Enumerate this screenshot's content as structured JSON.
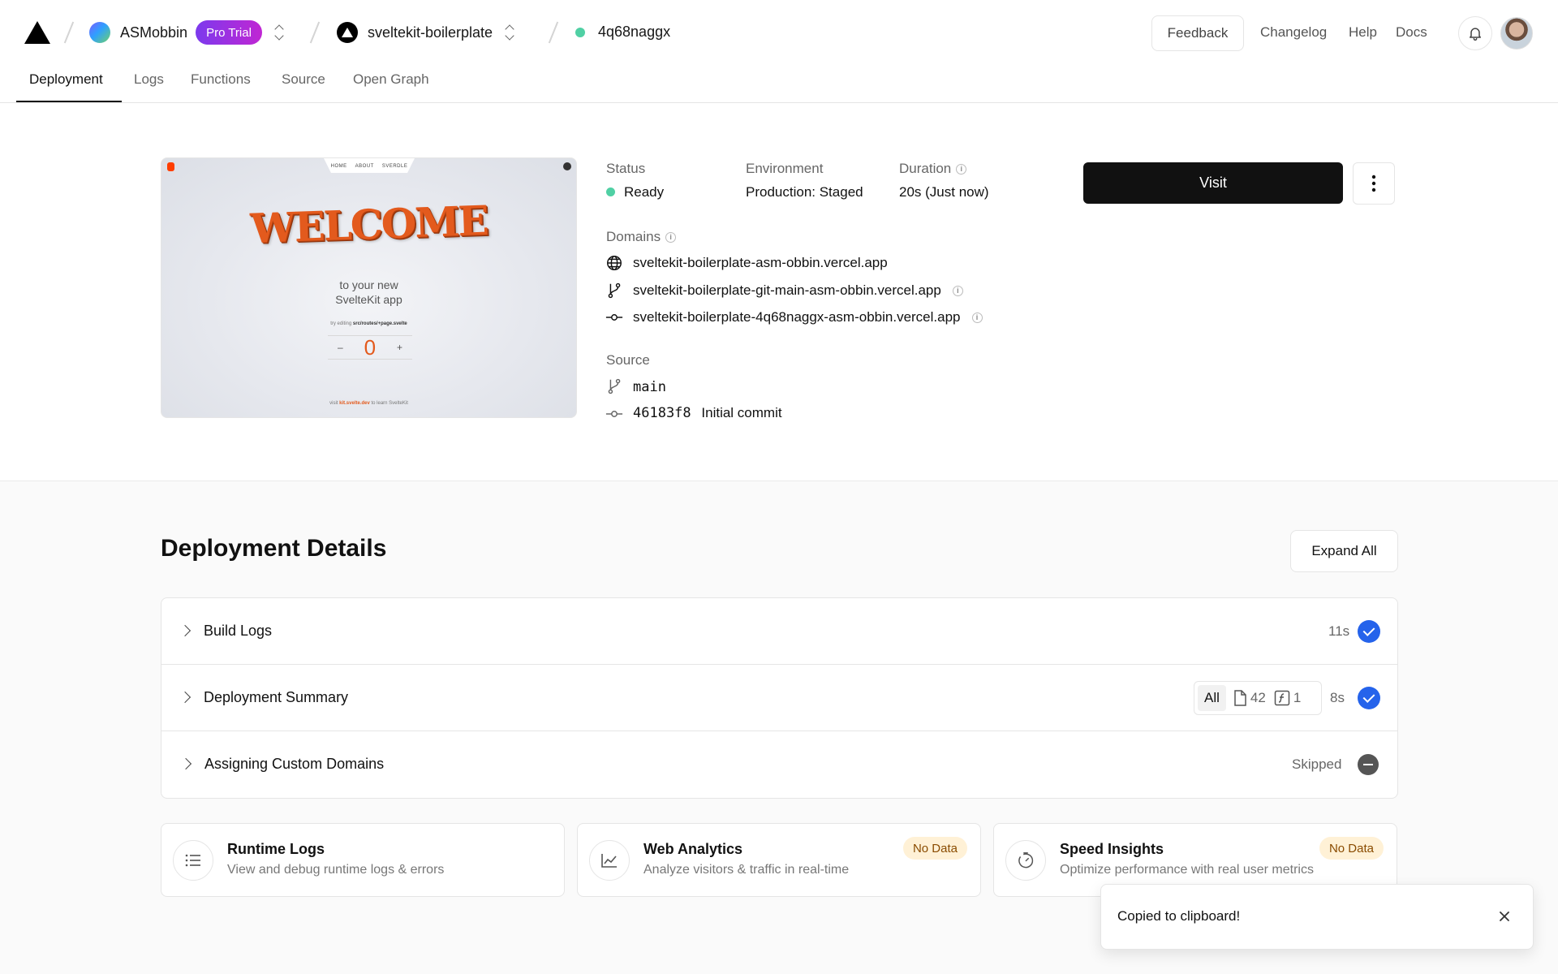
{
  "header": {
    "team_name": "ASMobbin",
    "plan_badge": "Pro Trial",
    "project_name": "sveltekit-boilerplate",
    "deployment_id": "4q68naggx",
    "feedback_label": "Feedback",
    "links": [
      "Changelog",
      "Help",
      "Docs"
    ]
  },
  "tabs": [
    "Deployment",
    "Logs",
    "Functions",
    "Source",
    "Open Graph"
  ],
  "preview": {
    "nav": [
      "HOME",
      "ABOUT",
      "SVERDLE"
    ],
    "heading": "WELCOME",
    "subtitle_line1": "to your new",
    "subtitle_line2": "SvelteKit app",
    "try_text": "try editing",
    "try_path": "src/routes/+page.svelte",
    "counter_minus": "–",
    "counter_value": "0",
    "counter_plus": "+",
    "footer_prefix": "visit",
    "footer_link": "kit.svelte.dev",
    "footer_suffix": "to learn SvelteKit"
  },
  "overview": {
    "status_label": "Status",
    "status_value": "Ready",
    "environment_label": "Environment",
    "environment_value": "Production: Staged",
    "duration_label": "Duration",
    "duration_value": "20s (Just now)",
    "domains_label": "Domains",
    "domains": [
      "sveltekit-boilerplate-asm-obbin.vercel.app",
      "sveltekit-boilerplate-git-main-asm-obbin.vercel.app",
      "sveltekit-boilerplate-4q68naggx-asm-obbin.vercel.app"
    ],
    "source_label": "Source",
    "branch": "main",
    "commit_hash": "46183f8",
    "commit_message": "Initial commit",
    "visit_label": "Visit"
  },
  "details": {
    "title": "Deployment Details",
    "expand_label": "Expand All",
    "rows": [
      {
        "label": "Build Logs",
        "time": "11s"
      },
      {
        "label": "Deployment Summary",
        "time": "8s",
        "filter_all": "All",
        "files": "42",
        "functions": "1"
      },
      {
        "label": "Assigning Custom Domains",
        "status": "Skipped"
      }
    ],
    "cards": [
      {
        "title": "Runtime Logs",
        "desc": "View and debug runtime logs & errors"
      },
      {
        "title": "Web Analytics",
        "desc": "Analyze visitors & traffic in real-time",
        "badge": "No Data"
      },
      {
        "title": "Speed Insights",
        "desc": "Optimize performance with real user metrics",
        "badge": "No Data"
      }
    ]
  },
  "toast": {
    "message": "Copied to clipboard!"
  },
  "colors": {
    "accent_blue": "#2563eb",
    "ready_green": "#50d0a4",
    "badge_purple": "#7c3aed"
  }
}
